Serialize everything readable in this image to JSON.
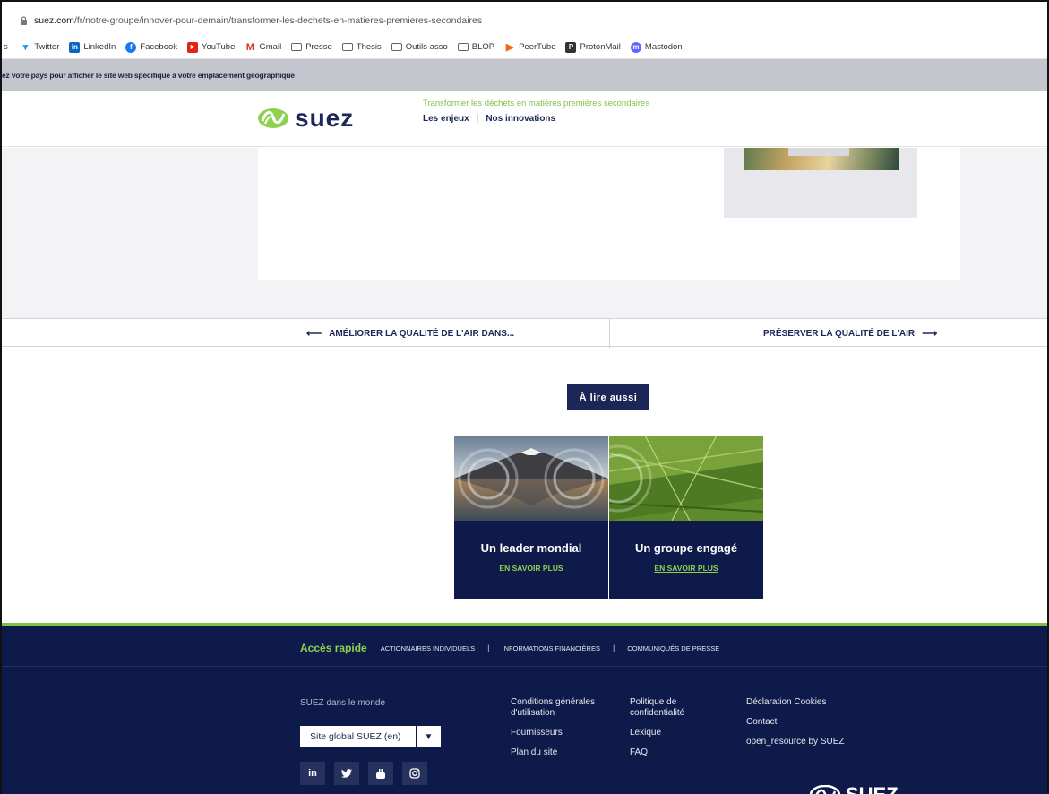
{
  "browser": {
    "url_host": "suez.com",
    "url_path": "/fr/notre-groupe/innover-pour-demain/transformer-les-dechets-en-matieres-premieres-secondaires",
    "bookmarks": [
      "Twitter",
      "LinkedIn",
      "Facebook",
      "YouTube",
      "Gmail",
      "Presse",
      "Thesis",
      "Outils asso",
      "BLOP",
      "PeerTube",
      "ProtonMail",
      "Mastodon"
    ]
  },
  "country_bar": {
    "text": "ez votre pays pour afficher le site web spécifique à votre emplacement géographique"
  },
  "header": {
    "logo_text": "suez",
    "kicker": "Transformer les déchets en matières premières secondaires",
    "nav": [
      "Les enjeux",
      "Nos innovations"
    ]
  },
  "article_nav": {
    "prev_label": "AMÉLIORER LA QUALITÉ DE L'AIR DANS...",
    "next_label": "PRÉSERVER LA QUALITÉ DE L'AIR"
  },
  "read_also": {
    "label": "À lire aussi",
    "tiles": [
      {
        "title": "Un leader mondial",
        "link": "EN SAVOIR PLUS"
      },
      {
        "title": "Un groupe engagé",
        "link": "EN SAVOIR PLUS"
      }
    ]
  },
  "footer": {
    "quick_title": "Accès rapide",
    "quick_links": [
      "ACTIONNAIRES INDIVIDUELS",
      "INFORMATIONS FINANCIÈRES",
      "COMMUNIQUÉS DE PRESSE"
    ],
    "world_label": "SUEZ dans le monde",
    "site_select": "Site global SUEZ (en)",
    "social": [
      "in",
      "🐦",
      "▶",
      "◎"
    ],
    "col1": [
      "Conditions générales d'utilisation",
      "Fournisseurs",
      "Plan du site"
    ],
    "col2": [
      "Politique de confidentialité",
      "Lexique",
      "FAQ"
    ],
    "col3": [
      "Déclaration Cookies",
      "Contact",
      "open_resource by SUEZ"
    ],
    "logo_text": "SUEZ"
  },
  "colors": {
    "navy": "#1c2757",
    "footer_navy": "#0e1a4a",
    "green": "#7cc243"
  }
}
